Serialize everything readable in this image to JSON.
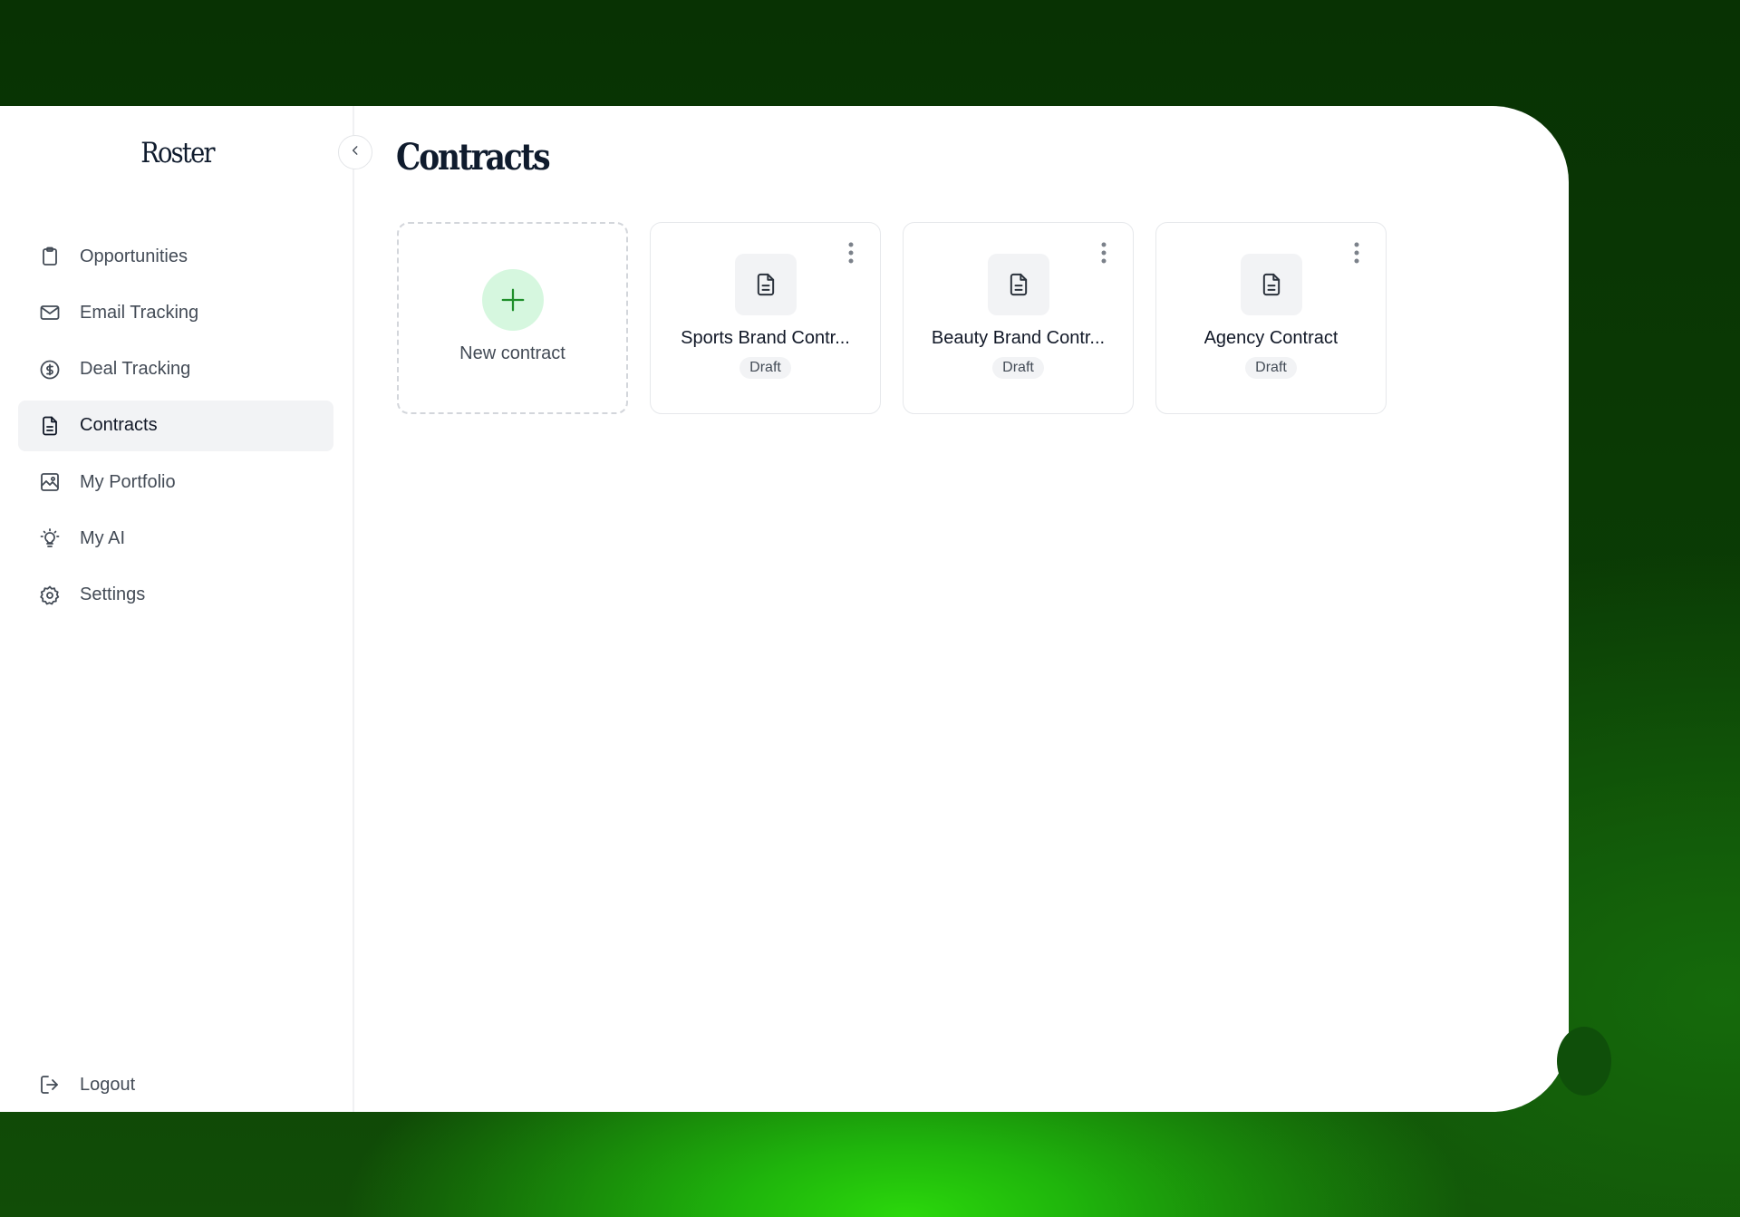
{
  "brand": {
    "name": "Roster"
  },
  "sidebar": {
    "items": [
      {
        "label": "Opportunities",
        "icon": "clipboard-icon",
        "active": false
      },
      {
        "label": "Email Tracking",
        "icon": "mail-icon",
        "active": false
      },
      {
        "label": "Deal Tracking",
        "icon": "dollar-circle-icon",
        "active": false
      },
      {
        "label": "Contracts",
        "icon": "document-icon",
        "active": true
      },
      {
        "label": "My Portfolio",
        "icon": "image-icon",
        "active": false
      },
      {
        "label": "My AI",
        "icon": "lightbulb-icon",
        "active": false
      },
      {
        "label": "Settings",
        "icon": "gear-icon",
        "active": false
      }
    ],
    "logout_label": "Logout"
  },
  "main": {
    "title": "Contracts",
    "new_contract_label": "New contract",
    "contracts": [
      {
        "title": "Sports Brand Contr...",
        "status": "Draft"
      },
      {
        "title": "Beauty Brand Contr...",
        "status": "Draft"
      },
      {
        "title": "Agency Contract",
        "status": "Draft"
      }
    ]
  },
  "colors": {
    "accent_green": "#1f8f2a",
    "accent_green_bg": "#d6f7df",
    "text_primary": "#111827",
    "text_secondary": "#434b56",
    "backdrop_dark": "#083203",
    "backdrop_bright": "#2bd80c"
  }
}
